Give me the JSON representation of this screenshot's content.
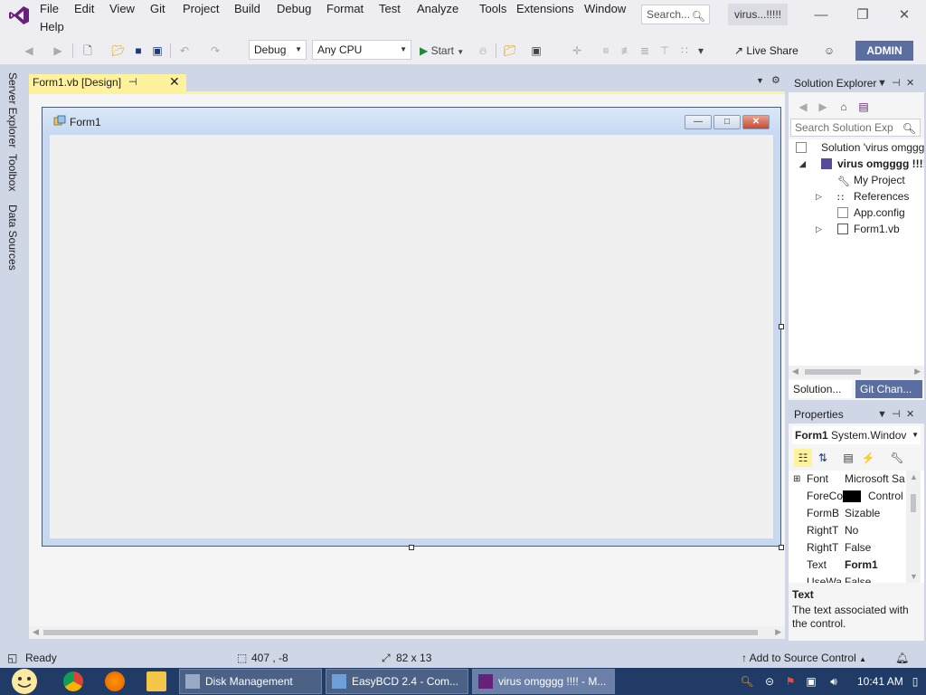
{
  "menu": {
    "items": [
      "File",
      "Edit",
      "View",
      "Git",
      "Project",
      "Build",
      "Debug",
      "Format",
      "Test",
      "Analyze",
      "Tools",
      "Extensions",
      "Window",
      "Help"
    ],
    "search_placeholder": "Search...",
    "solution_title": "virus...!!!!!"
  },
  "toolbar": {
    "config": "Debug",
    "platform": "Any CPU",
    "start_label": "Start",
    "live_share": "Live Share",
    "admin": "ADMIN"
  },
  "left_rail": {
    "tabs": [
      "Server Explorer",
      "Toolbox",
      "Data Sources"
    ]
  },
  "document": {
    "tab_label": "Form1.vb [Design]",
    "form_title": "Form1"
  },
  "solution_explorer": {
    "title": "Solution Explorer",
    "search_placeholder": "Search Solution Exp",
    "tree": [
      {
        "label": "Solution 'virus omggggg"
      },
      {
        "label": "virus omgggg !!!!"
      },
      {
        "label": "My Project"
      },
      {
        "label": "References"
      },
      {
        "label": "App.config"
      },
      {
        "label": "Form1.vb"
      }
    ],
    "bottom_tabs": [
      "Solution...",
      "Git Chan..."
    ]
  },
  "properties": {
    "title": "Properties",
    "object_name": "Form1",
    "object_type": "System.Windov",
    "rows": [
      {
        "name": "Font",
        "value": "Microsoft Sa"
      },
      {
        "name": "ForeCo",
        "value": "Control"
      },
      {
        "name": "FormB",
        "value": "Sizable"
      },
      {
        "name": "RightT",
        "value": "No"
      },
      {
        "name": "RightT",
        "value": "False"
      },
      {
        "name": "Text",
        "value": "Form1"
      },
      {
        "name": "UseWa",
        "value": "False"
      }
    ],
    "desc_title": "Text",
    "desc_text": "The text associated with the control."
  },
  "statusbar": {
    "ready": "Ready",
    "position": "407 , -8",
    "size": "82 x 13",
    "source_control": "Add to Source Control"
  },
  "taskbar": {
    "tasks": [
      "Disk Management",
      "EasyBCD 2.4 - Com...",
      "virus omgggg !!!! - M..."
    ],
    "clock": "10:41 AM"
  },
  "colors": {
    "vs_purple": "#68217a",
    "doc_tab_yellow": "#fff29d",
    "admin_bg": "#5a6ea0",
    "taskbar_bg": "#1f3b66"
  }
}
